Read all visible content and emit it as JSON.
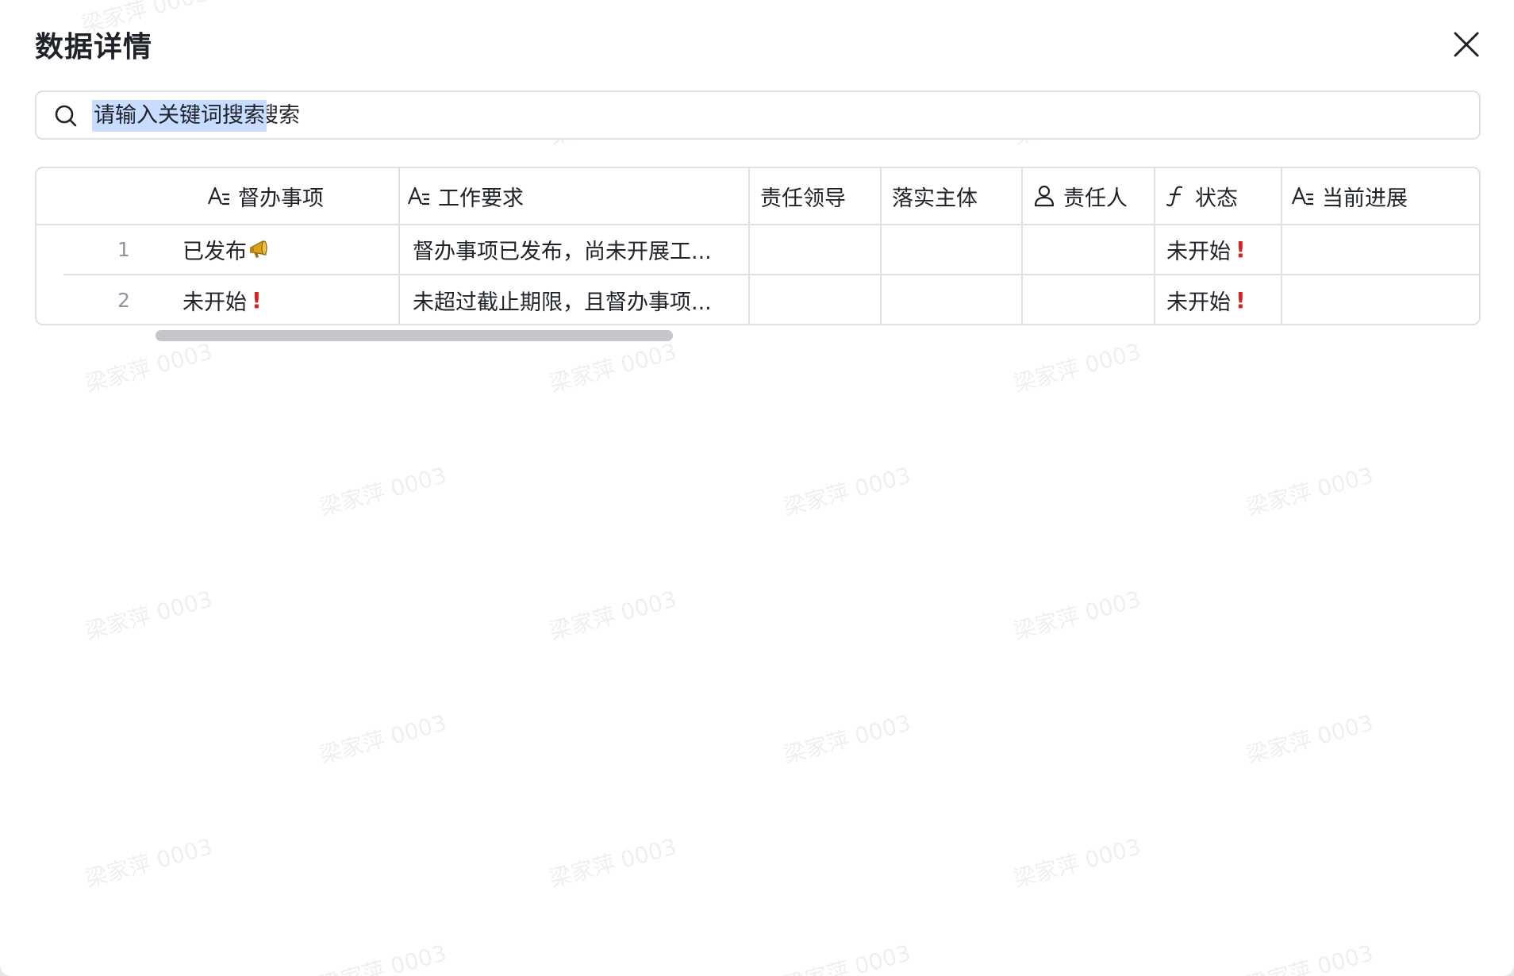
{
  "dialog": {
    "title": "数据详情"
  },
  "search": {
    "placeholder": "请输入关键词搜索"
  },
  "table": {
    "columns": [
      {
        "label": "督办事项",
        "icon": "text-field-icon"
      },
      {
        "label": "工作要求",
        "icon": "text-field-icon"
      },
      {
        "label": "责任领导",
        "icon": ""
      },
      {
        "label": "落实主体",
        "icon": ""
      },
      {
        "label": "责任人",
        "icon": "person-icon"
      },
      {
        "label": "状态",
        "icon": "formula-icon"
      },
      {
        "label": "当前进展",
        "icon": "text-field-icon"
      }
    ],
    "rows": [
      {
        "index": "1",
        "item": "已发布",
        "item_emoji": "megaphone-icon",
        "requirement": "督办事项已发布，尚未开展工...",
        "leader": "",
        "entity": "",
        "owner": "",
        "status": "未开始",
        "status_emoji": "exclamation-icon",
        "progress": ""
      },
      {
        "index": "2",
        "item": "未开始",
        "item_emoji": "exclamation-icon",
        "requirement": "未超过截止期限，且督办事项...",
        "leader": "",
        "entity": "",
        "owner": "",
        "status": "未开始",
        "status_emoji": "exclamation-icon",
        "progress": ""
      }
    ]
  },
  "watermark": {
    "text": "梁家萍 0003"
  },
  "colors": {
    "border": "#dee0e3",
    "selection": "#c7dcff",
    "alert": "#e0201f",
    "scrollbar": "#c4c6ca"
  }
}
